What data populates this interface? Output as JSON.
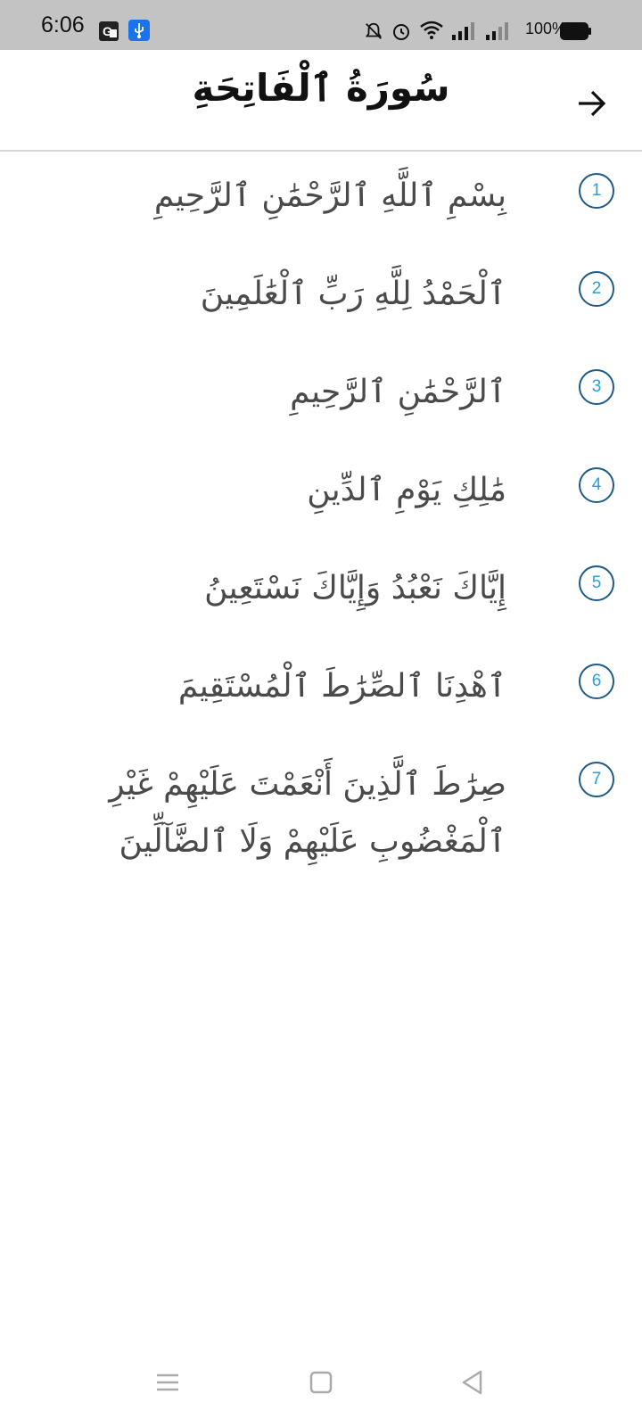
{
  "status_bar": {
    "time": "6:06",
    "battery_percent": "100%",
    "icons": [
      "translate-icon",
      "usb-icon",
      "mute-icon",
      "alarm-icon",
      "wifi-icon",
      "signal-icon",
      "signal-icon",
      "battery-icon"
    ]
  },
  "app_bar": {
    "title": "سُورَةُ ٱلْفَاتِحَةِ",
    "back_icon": "arrow-right-icon"
  },
  "verses": [
    {
      "number": "1",
      "text": "بِسْمِ ٱللَّهِ ٱلرَّحْمَٰنِ ٱلرَّحِيمِ"
    },
    {
      "number": "2",
      "text": "ٱلْحَمْدُ لِلَّهِ رَبِّ ٱلْعَٰلَمِينَ"
    },
    {
      "number": "3",
      "text": "ٱلرَّحْمَٰنِ ٱلرَّحِيمِ"
    },
    {
      "number": "4",
      "text": "مَٰلِكِ يَوْمِ ٱلدِّينِ"
    },
    {
      "number": "5",
      "text": "إِيَّاكَ نَعْبُدُ وَإِيَّاكَ نَسْتَعِينُ"
    },
    {
      "number": "6",
      "text": "ٱهْدِنَا ٱلصِّرَٰطَ ٱلْمُسْتَقِيمَ"
    },
    {
      "number": "7",
      "text": "صِرَٰطَ ٱلَّذِينَ أَنْعَمْتَ عَلَيْهِمْ غَيْرِ ٱلْمَغْضُوبِ عَلَيْهِمْ وَلَا ٱلضَّآلِّينَ"
    }
  ],
  "nav_bar": {
    "icons": [
      "menu-icon",
      "home-square-icon",
      "back-triangle-icon"
    ]
  },
  "colors": {
    "status_bar_bg": "#c3c3c3",
    "verse_text": "#4a4a4a",
    "badge_border": "#1e5b86",
    "badge_number": "#2aa0d8",
    "usb_badge": "#1a73e8"
  }
}
